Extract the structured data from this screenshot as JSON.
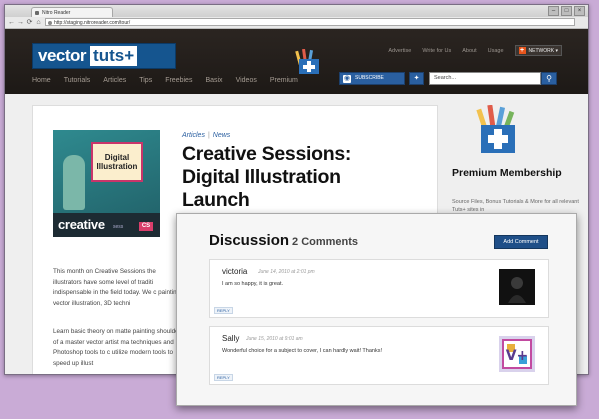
{
  "browser": {
    "tab_title": "Nitro Reader",
    "url": "http://staging.nitroreader.com/tour/",
    "controls": [
      "–",
      "□",
      "×"
    ],
    "nav": [
      "←",
      "→",
      "⟳",
      "⌂"
    ]
  },
  "header": {
    "logo_vector": "vector",
    "logo_tuts": "tuts+",
    "top_links": [
      "Advertise",
      "Write for Us",
      "About",
      "Usage"
    ],
    "network_label": "NETWORK ▾",
    "nav_items": [
      "Home",
      "Tutorials",
      "Articles",
      "Tips",
      "Freebies",
      "Basix",
      "Videos",
      "Premium"
    ],
    "subscribe_label": "SUBSCRIBE",
    "search_placeholder": "Search...",
    "accent": "#2a5fa0"
  },
  "article": {
    "categories": [
      "Articles",
      "News"
    ],
    "title": "Creative Sessions: Digital Illustration Launch",
    "thumb": {
      "frame_text": "Digital Illustration",
      "creative": "creative",
      "sess": "sess",
      "cs": "CS"
    },
    "para1": "This month on Creative Sessions the illustrators have some level of traditi indispensable in the field today. We c painting, vector illustration, 3D techni",
    "para2": "Learn basic theory on matte painting shoulder of a master vector artist ma techniques and Photoshop tools to c utilize modern tools to speed up illust"
  },
  "sidebar": {
    "heading": "Premium Membership",
    "text": "Source Files, Bonus Tutorials & More for all relevant Tuts+ sites in"
  },
  "discussion": {
    "heading": "Discussion",
    "count": "2 Comments",
    "add_label": "Add Comment",
    "comments": [
      {
        "name": "victoria",
        "date": "June 14, 2010 at 2:01 pm",
        "text": "I am so happy, it is great.",
        "reply": "REPLY"
      },
      {
        "name": "Sally",
        "date": "June 15, 2010 at 9:01 am",
        "text": "Wonderful choice for a subject to cover, I can hardly wait! Thanks!",
        "reply": "REPLY"
      }
    ]
  }
}
